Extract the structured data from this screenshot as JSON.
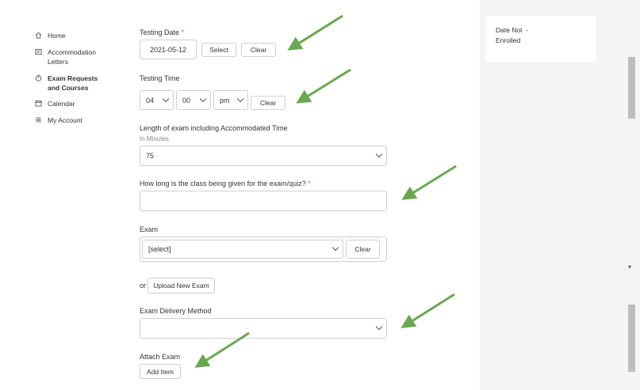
{
  "nav": {
    "items": [
      {
        "label": "Home",
        "icon": "home-icon"
      },
      {
        "label": "Accommodation Letters",
        "icon": "letter-icon"
      },
      {
        "label": "Exam Requests and Courses",
        "icon": "stopwatch-icon",
        "active": true
      },
      {
        "label": "Calendar",
        "icon": "calendar-icon"
      },
      {
        "label": "My Account",
        "icon": "gear-icon"
      }
    ]
  },
  "form": {
    "testing_date": {
      "label": "Testing Date",
      "required": "*",
      "value": "2021-05-12",
      "select_label": "Select",
      "clear_label": "Clear"
    },
    "testing_time": {
      "label": "Testing Time",
      "hour": "04",
      "minute": "00",
      "ampm": "pm",
      "clear_label": "Clear"
    },
    "length": {
      "label": "Length of exam including Accommodated Time",
      "sublabel": "In Minutes",
      "value": "75"
    },
    "class_length": {
      "label": "How long is the class being given for the exam/quiz?",
      "required": "*",
      "value": ""
    },
    "exam": {
      "label": "Exam",
      "value": "[select]",
      "clear_label": "Clear"
    },
    "upload": {
      "or_text": "or",
      "button_label": "Upload New Exam"
    },
    "delivery": {
      "label": "Exam Delivery Method",
      "value": ""
    },
    "attach": {
      "label": "Attach Exam",
      "button_label": "Add Item"
    }
  },
  "right_card": {
    "line1_label": "Date Not",
    "line1_value": "-",
    "line2_label": "Enrolled"
  },
  "colors": {
    "arrow": "#6aa84f",
    "required": "#d9534f",
    "border": "#cfcfcf"
  }
}
